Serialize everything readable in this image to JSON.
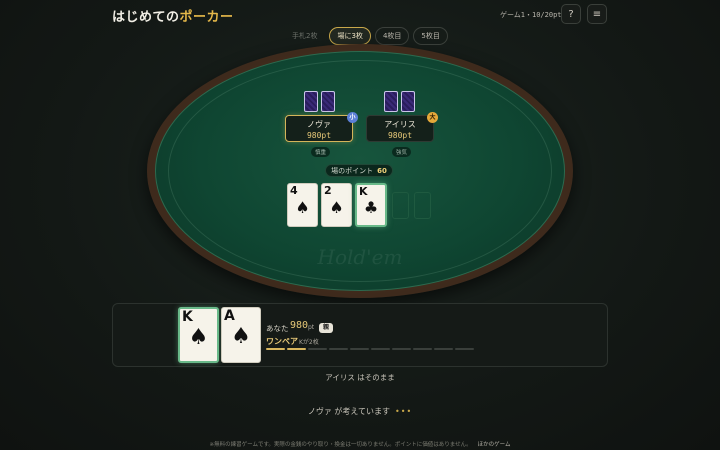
{
  "header": {
    "title_main": "はじめての",
    "title_accent": "ポーカー",
    "score": "ゲーム1・10/20pt",
    "help_icon": "?",
    "menu_icon": "≡"
  },
  "stages": [
    {
      "label": "手札2枚",
      "state": "done"
    },
    {
      "label": "場に3枚",
      "state": "active"
    },
    {
      "label": "4枚目",
      "state": "future"
    },
    {
      "label": "5枚目",
      "state": "future"
    }
  ],
  "players": [
    {
      "name": "ノヴァ",
      "chips": "980pt",
      "badge": "小",
      "style": "慎重"
    },
    {
      "name": "アイリス",
      "chips": "980pt",
      "badge": "大",
      "style": "強気"
    }
  ],
  "pot": {
    "label": "場のポイント",
    "amount": "60"
  },
  "community_cards": [
    {
      "rank": "4",
      "suit": "♠"
    },
    {
      "rank": "2",
      "suit": "♠"
    },
    {
      "rank": "K",
      "suit": "♣"
    }
  ],
  "watermark": "Hold'em",
  "hand": {
    "cards": [
      {
        "rank": "K",
        "suit": "♠"
      },
      {
        "rank": "A",
        "suit": "♠"
      }
    ],
    "you_label": "あなた",
    "chips": "980",
    "unit": "pt",
    "badge": "親",
    "hand_name": "ワンペア",
    "hand_desc": "Kが2枚",
    "strength_fraction": 0.2
  },
  "messages": {
    "last_action": "アイリス はそのまま",
    "thinking": "ノヴァ が考えています",
    "dots": "•••"
  },
  "footer": {
    "disclaimer": "※無料の練習ゲームです。実際の金銭のやり取り・換金は一切ありません。ポイントに価値はありません。",
    "link": "ほかのゲーム"
  }
}
